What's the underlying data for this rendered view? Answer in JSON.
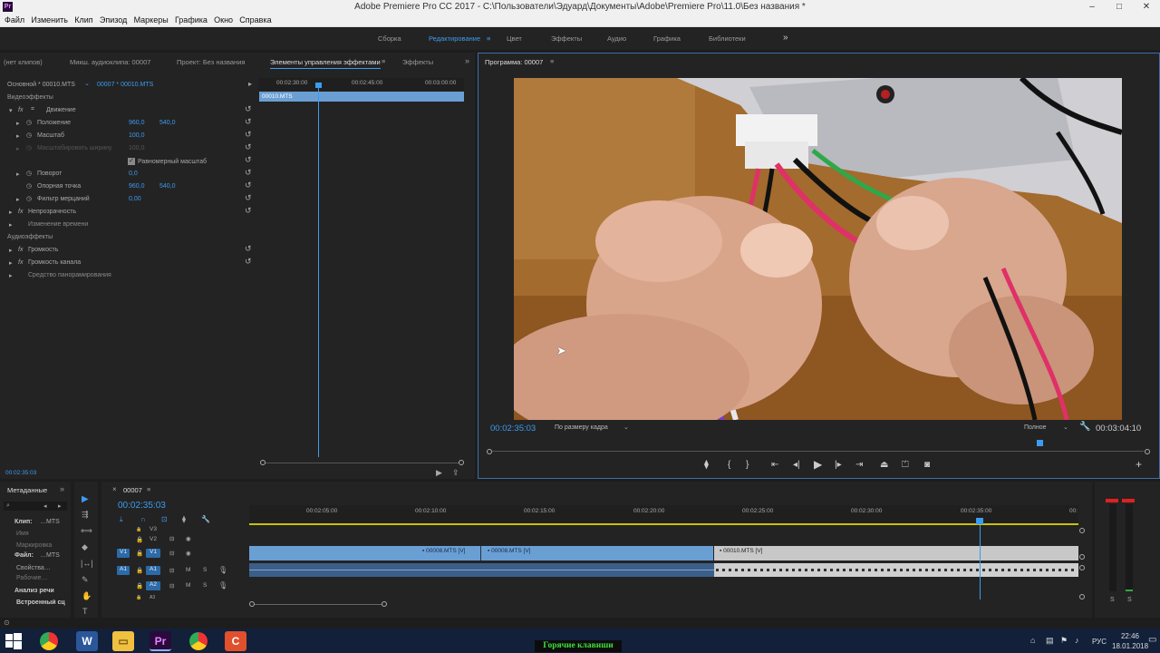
{
  "window": {
    "title": "Adobe Premiere Pro CC 2017 - C:\\Пользователи\\Эдуард\\Документы\\Adobe\\Premiere Pro\\11.0\\Без названия *",
    "logo": "Pr"
  },
  "menu": [
    "Файл",
    "Изменить",
    "Клип",
    "Эпизод",
    "Маркеры",
    "Графика",
    "Окно",
    "Справка"
  ],
  "workspaces": [
    "Сборка",
    "Редактирование",
    "Цвет",
    "Эффекты",
    "Аудио",
    "Графика",
    "Библиотеки"
  ],
  "workspace_active": "Редактирование",
  "source_panel": {
    "tabs": [
      "(нет клипов)",
      "Микш. аудиоклипа: 00007",
      "Проект: Без названия",
      "Элементы управления эффектами",
      "Эффекты"
    ],
    "clip_path": "Основной * 00010.MTS",
    "clip_seq": "00007 * 00010.MTS",
    "ruler": [
      "00:02:30:00",
      "00:02:45:00",
      "00:03:00:00"
    ],
    "clip_label": "00010.MTS",
    "video_effects_header": "Видеоэффекты",
    "motion": "Движение",
    "position_label": "Положение",
    "position_x": "960,0",
    "position_y": "540,0",
    "scale_label": "Масштаб",
    "scale_value": "100,0",
    "scale_width_label": "Масштабировать ширину",
    "scale_width_value": "100,0",
    "uniform_scale": "Равномерный масштаб",
    "rotation_label": "Поворот",
    "rotation_value": "0,0",
    "anchor_label": "Опорная точка",
    "anchor_x": "960,0",
    "anchor_y": "540,0",
    "flicker_label": "Фильтр мерцаний",
    "flicker_value": "0,00",
    "opacity": "Непрозрачность",
    "time_remap": "Изменение времени",
    "audio_effects_header": "Аудиоэффекты",
    "volume": "Громкость",
    "channel_volume": "Громкость канала",
    "panner": "Средство панорамирования",
    "timecode": "00:02:35:03"
  },
  "program_monitor": {
    "title": "Программа: 00007",
    "timecode": "00:02:35:03",
    "fit": "По размеру кадра",
    "quality": "Полное",
    "duration": "00:03:04:10",
    "playhead_fraction": 0.84
  },
  "metadata_panel": {
    "tab": "Метаданные",
    "rows": [
      "Клип:",
      "…MTS",
      "Имя",
      "Маркировка",
      "Файл:",
      "…MTS",
      "Свойства…",
      "Рабочие…",
      "Анализ речи",
      "Встроенный сц"
    ]
  },
  "timeline": {
    "tab": "00007",
    "timecode": "00:02:35:03",
    "ruler": [
      "00:02:05:00",
      "00:02:10:00",
      "00:02:15:00",
      "00:02:20:00",
      "00:02:25:00",
      "00:02:30:00",
      "00:02:35:00",
      "00:"
    ],
    "tracks": [
      {
        "id": "V3",
        "name": "V3"
      },
      {
        "id": "V2",
        "name": "V2"
      },
      {
        "id": "V1",
        "name": "V1"
      },
      {
        "id": "A1",
        "name": "A1"
      },
      {
        "id": "A2",
        "name": "A2"
      },
      {
        "id": "A3",
        "name": "A3"
      }
    ],
    "clips": [
      "00008.MTS [V]",
      "00008.MTS [V]",
      "00010.MTS [V]"
    ],
    "track_buttons": {
      "mute": "M",
      "solo": "S"
    }
  },
  "audio_meter": {
    "labels": [
      "S",
      "S"
    ]
  },
  "taskbar": {
    "hotkeys_label": "Горячие клавиши",
    "lang": "РУС",
    "time": "22:46",
    "date": "18.01.2018"
  },
  "colors": {
    "accent": "#3d9bf0",
    "clip_blue": "#6a9fd4",
    "clip_gray": "#c8c8c8"
  }
}
